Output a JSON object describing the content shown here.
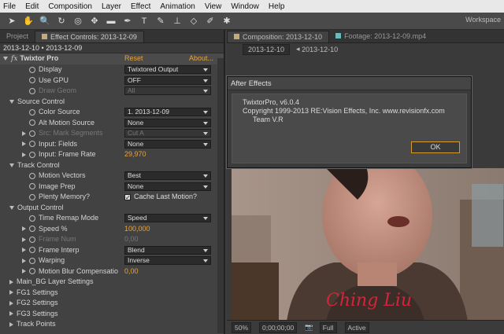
{
  "menu": [
    "File",
    "Edit",
    "Composition",
    "Layer",
    "Effect",
    "Animation",
    "View",
    "Window",
    "Help"
  ],
  "toolbar": {
    "workspace_label": "Workspace"
  },
  "left_panel": {
    "tabs": [
      "Project",
      "Effect Controls: 2013-12-09"
    ],
    "subheader": "2013-12-10 • 2013-12-09",
    "effect": {
      "name": "Twixtor Pro",
      "reset": "Reset",
      "about": "About..."
    },
    "rows": [
      {
        "label": "Display",
        "value": "Twixtored Output",
        "type": "dropdown"
      },
      {
        "label": "Use GPU",
        "value": "OFF",
        "type": "dropdown"
      },
      {
        "label": "Draw Geom",
        "value": "All",
        "type": "dropdown",
        "dim": true
      },
      {
        "label": "Source Control",
        "type": "group"
      },
      {
        "label": "Color Source",
        "value": "1. 2013-12-09",
        "type": "dropdown"
      },
      {
        "label": "Alt Motion Source",
        "value": "None",
        "type": "dropdown"
      },
      {
        "label": "Src: Mark Segments",
        "value": "Cut A",
        "type": "dropdown",
        "dim": true
      },
      {
        "label": "Input: Fields",
        "value": "None",
        "type": "dropdown"
      },
      {
        "label": "Input: Frame Rate",
        "value": "29,970",
        "type": "number"
      },
      {
        "label": "Track Control",
        "type": "group"
      },
      {
        "label": "Motion Vectors",
        "value": "Best",
        "type": "dropdown"
      },
      {
        "label": "Image Prep",
        "value": "None",
        "type": "dropdown"
      },
      {
        "label": "Plenty Memory?",
        "value": "Cache Last Motion?",
        "type": "checkbox"
      },
      {
        "label": "Output Control",
        "type": "group"
      },
      {
        "label": "Time Remap Mode",
        "value": "Speed",
        "type": "dropdown"
      },
      {
        "label": "Speed %",
        "value": "100,000",
        "type": "number"
      },
      {
        "label": "Frame Num",
        "value": "0,00",
        "type": "number",
        "dim": true
      },
      {
        "label": "Frame Interp",
        "value": "Blend",
        "type": "dropdown"
      },
      {
        "label": "Warping",
        "value": "Inverse",
        "type": "dropdown"
      },
      {
        "label": "Motion Blur Compensatio",
        "value": "0,00",
        "type": "number"
      },
      {
        "label": "Main_BG Layer Settings",
        "type": "section"
      },
      {
        "label": "FG1 Settings",
        "type": "section"
      },
      {
        "label": "FG2 Settings",
        "type": "section"
      },
      {
        "label": "FG3 Settings",
        "type": "section"
      },
      {
        "label": "Track Points",
        "type": "section"
      }
    ]
  },
  "right_panel": {
    "tabs": [
      "Composition: 2013-12-10",
      "Footage: 2013-12-09.mp4"
    ],
    "crumbs": [
      "2013-12-10",
      "2013-12-10"
    ],
    "bottombar": [
      "50%",
      "0;00;00;00",
      "Full",
      "Active"
    ],
    "watermark": "Ching Liu"
  },
  "dialog": {
    "title": "After Effects",
    "line1": "TwixtorPro, v6.0.4",
    "line2": "Copyright 1999-2013 RE:Vision Effects, Inc. www.revisionfx.com",
    "line3": "Team V.R",
    "ok": "OK"
  }
}
